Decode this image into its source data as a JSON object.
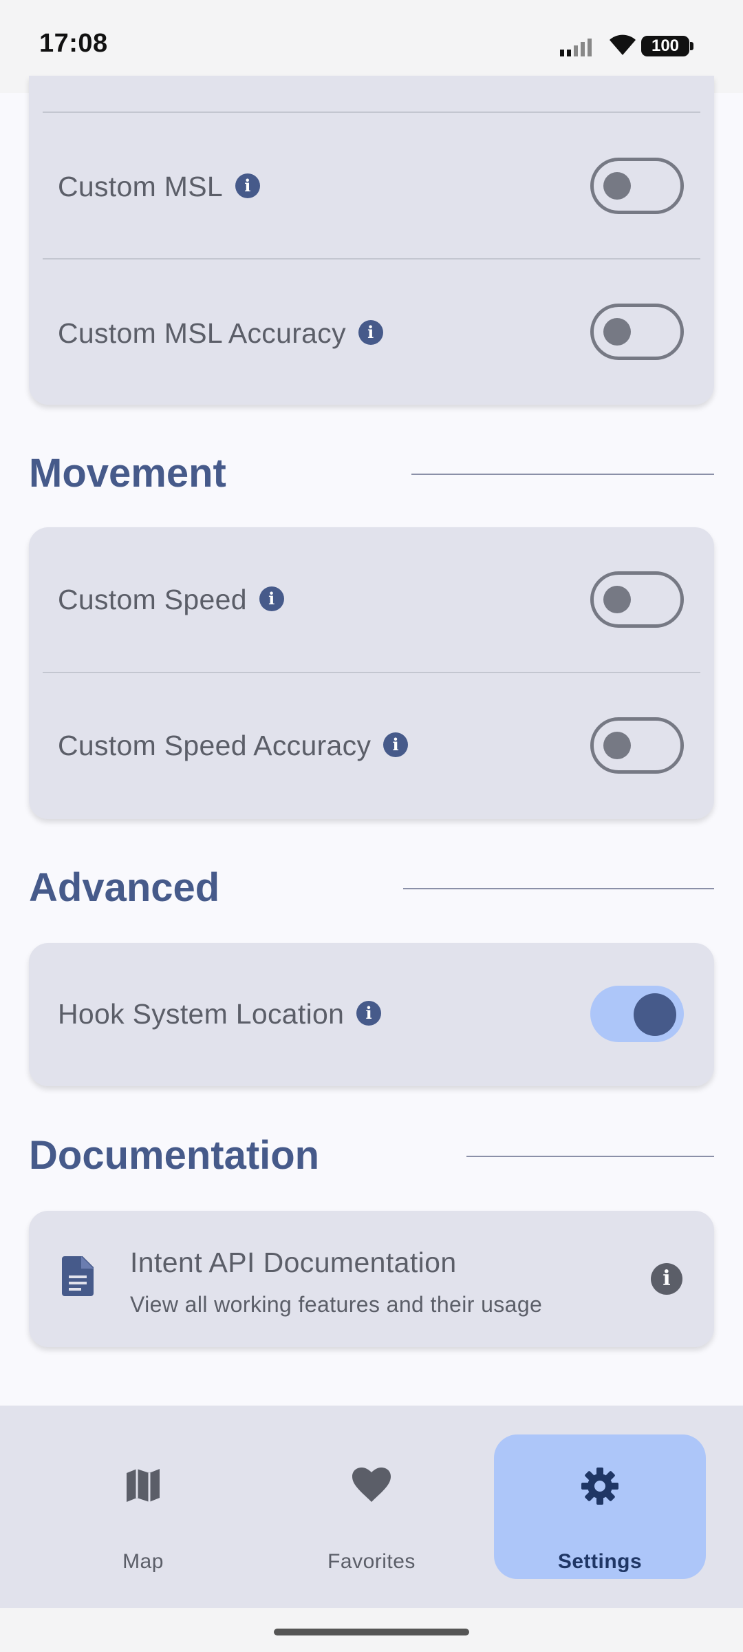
{
  "status_bar": {
    "time": "17:08",
    "battery": "100"
  },
  "sections": {
    "location": {
      "rows": [
        {
          "label": "Custom MSL",
          "enabled": false
        },
        {
          "label": "Custom MSL Accuracy",
          "enabled": false
        }
      ]
    },
    "movement": {
      "title": "Movement",
      "rows": [
        {
          "label": "Custom Speed",
          "enabled": false
        },
        {
          "label": "Custom Speed Accuracy",
          "enabled": false
        }
      ]
    },
    "advanced": {
      "title": "Advanced",
      "rows": [
        {
          "label": "Hook System Location",
          "enabled": true
        }
      ]
    },
    "documentation": {
      "title": "Documentation",
      "item": {
        "title": "Intent API Documentation",
        "subtitle": "View all working features and their usage"
      }
    }
  },
  "bottom_nav": {
    "items": [
      {
        "label": "Map",
        "icon": "map-icon",
        "active": false
      },
      {
        "label": "Favorites",
        "icon": "heart-icon",
        "active": false
      },
      {
        "label": "Settings",
        "icon": "gear-icon",
        "active": true
      }
    ]
  },
  "colors": {
    "accent": "#465a8a",
    "card": "#e1e2ec",
    "active_nav": "#adc6f9",
    "background": "#f9f9fd"
  },
  "info_glyph": "i"
}
